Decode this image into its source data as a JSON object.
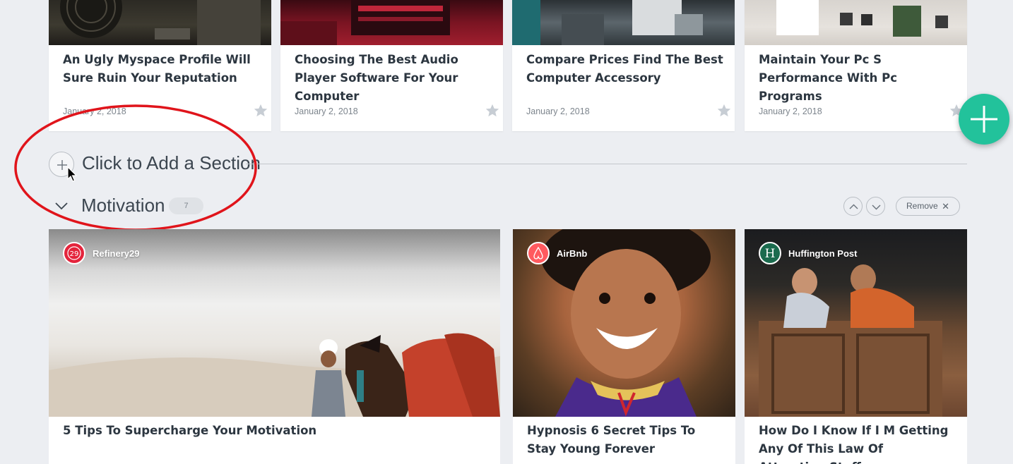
{
  "top_cards": [
    {
      "title": "An Ugly Myspace Profile Will Sure Ruin Your Reputation",
      "date": "January 2, 2018",
      "favorite_icon": "star-icon"
    },
    {
      "title": "Choosing The Best Audio Player Software For Your Computer",
      "date": "January 2, 2018",
      "favorite_icon": "star-icon"
    },
    {
      "title": "Compare Prices Find The Best Computer Accessory",
      "date": "January 2, 2018",
      "favorite_icon": "star-icon"
    },
    {
      "title": "Maintain Your Pc S Performance With Pc Programs",
      "date": "January 2, 2018",
      "favorite_icon": "star-icon"
    }
  ],
  "add_section": {
    "label": "Click to Add a Section",
    "icon": "plus-icon"
  },
  "section": {
    "title": "Motivation",
    "count": "7",
    "remove_label": "Remove",
    "remove_icon": "close-icon",
    "move_up_icon": "chevron-up-icon",
    "move_down_icon": "chevron-down-icon",
    "collapse_icon": "chevron-down-icon"
  },
  "motivation_cards": [
    {
      "source": "Refinery29",
      "title": "5 Tips To Supercharge Your Motivation"
    },
    {
      "source": "AirBnb",
      "title": "Hypnosis 6 Secret Tips To Stay Young Forever"
    },
    {
      "source": "Huffington Post",
      "title": "How Do I Know If I M Getting Any Of This Law Of Attraction Stuff"
    }
  ],
  "colors": {
    "background": "#eceef2",
    "accent": "#22c29b",
    "annotation": "#e0141b",
    "refinery29": "#e4243c",
    "airbnb": "#ff5a5f",
    "huffington": "#1b6b4e"
  },
  "fab_icon": "plus-icon"
}
